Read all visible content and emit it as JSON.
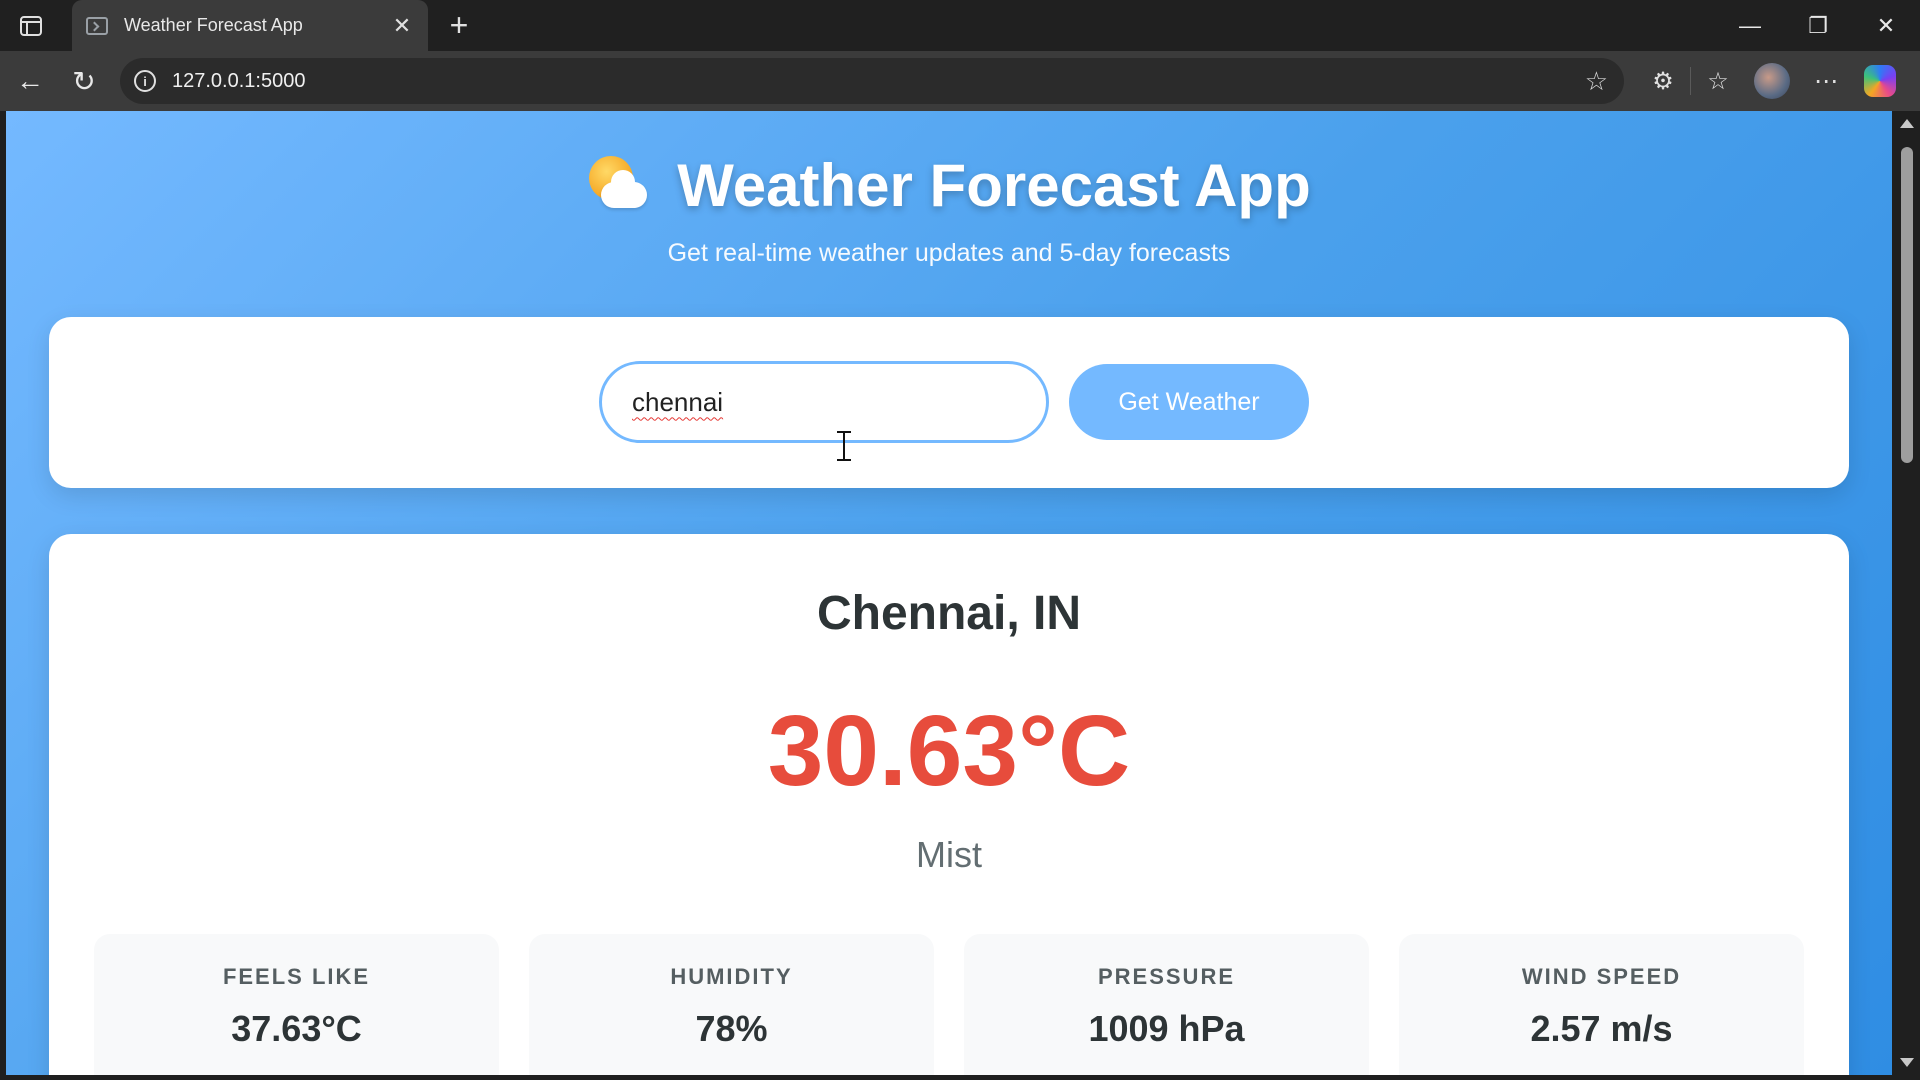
{
  "browser": {
    "tab_title": "Weather Forecast App",
    "url": "127.0.0.1:5000"
  },
  "header": {
    "title": "Weather Forecast App",
    "subtitle": "Get real-time weather updates and 5-day forecasts"
  },
  "search": {
    "value": "chennai",
    "button_label": "Get Weather"
  },
  "weather": {
    "city": "Chennai, IN",
    "temperature": "30.63°C",
    "description": "Mist",
    "stats": [
      {
        "label": "FEELS LIKE",
        "value": "37.63°C"
      },
      {
        "label": "HUMIDITY",
        "value": "78%"
      },
      {
        "label": "PRESSURE",
        "value": "1009 hPa"
      },
      {
        "label": "WIND SPEED",
        "value": "2.57 m/s"
      }
    ]
  },
  "colors": {
    "accent": "#74b9ff",
    "temperature": "#e74c3c"
  }
}
